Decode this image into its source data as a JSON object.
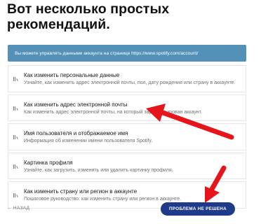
{
  "heading": {
    "line1": "Вот несколько простых",
    "line2": "рекомендаций."
  },
  "banner": {
    "text": "Вы можете управлять данными аккаунта на странице https://www.spotify.com/account/"
  },
  "items": [
    {
      "title": "Как изменить персональные данные",
      "desc": "Узнайте, как изменить адрес электронной почты, пол, дату рождения или страну в аккаунте."
    },
    {
      "title": "Как изменить адрес электронной почты",
      "desc": "Как изменить адрес электронной почты, на который зарегистрирован аккаунт."
    },
    {
      "title": "Имя пользователя и отображаемое имя",
      "desc": "Информация об изменении имени пользователя Spotify."
    },
    {
      "title": "Картинка профиля",
      "desc": "Узнайте, как загрузить, изменить или удалить картинку профиля."
    },
    {
      "title": "Как изменить страну или регион в аккаунте",
      "desc": "Пошаговое руководство: как изменить страну или регион в аккаунте."
    }
  ],
  "footer": {
    "back_label": "← НАЗАД",
    "problem_label": "ПРОБЛЕМА НЕ РЕШЕНА"
  },
  "colors": {
    "banner": "#5391b8",
    "button": "#1e3a8a",
    "arrow": "#e8141b"
  }
}
